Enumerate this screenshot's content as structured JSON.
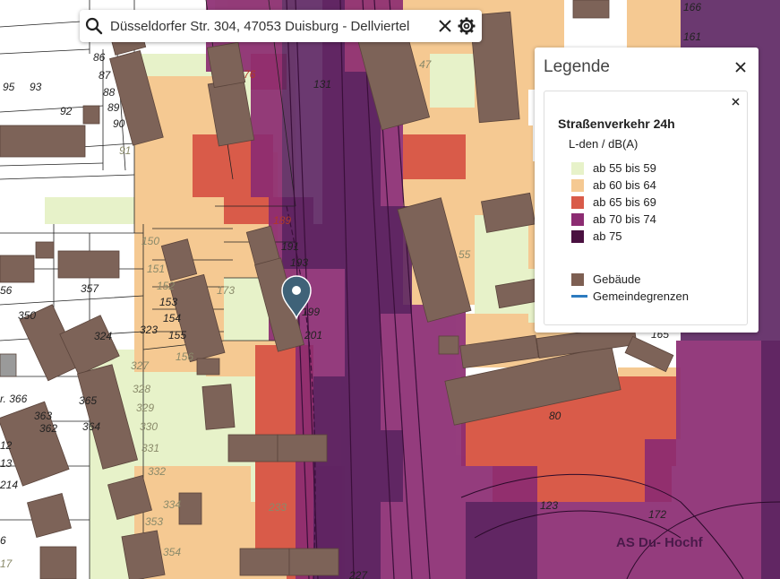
{
  "search": {
    "value": "Düsseldorfer Str. 304, 47053 Duisburg - Dellviertel"
  },
  "legend": {
    "title": "Legende",
    "layer_title": "Straßenverkehr 24h",
    "layer_subtitle": "L-den / dB(A)",
    "noise_classes": [
      {
        "label": "ab 55 bis 59",
        "color": "#e7f2c9"
      },
      {
        "label": "ab 60 bis 64",
        "color": "#f5c992"
      },
      {
        "label": "ab 65 bis 69",
        "color": "#d95b49"
      },
      {
        "label": "ab 70 bis 74",
        "color": "#8c2c72"
      },
      {
        "label": "ab 75",
        "color": "#4a1040"
      }
    ],
    "other_items": [
      {
        "label": "Gebäude",
        "color": "#7d5f52",
        "kind": "fill"
      },
      {
        "label": "Gemeindegrenzen",
        "color": "#2c7bbf",
        "kind": "line"
      }
    ]
  },
  "map": {
    "marker": "location-pin",
    "colors": {
      "building": "#7d6358",
      "building_dark": "#6b5148",
      "parcel_line": "#222222",
      "rail_line": "#5a2a5a"
    },
    "parcel_labels": [
      {
        "t": "166"
      },
      {
        "t": "161"
      },
      {
        "t": "95"
      },
      {
        "t": "93"
      },
      {
        "t": "92"
      },
      {
        "t": "86"
      },
      {
        "t": "87"
      },
      {
        "t": "88"
      },
      {
        "t": "89"
      },
      {
        "t": "90"
      },
      {
        "t": "91"
      },
      {
        "t": "76"
      },
      {
        "t": "131"
      },
      {
        "t": "47"
      },
      {
        "t": "189"
      },
      {
        "t": "191"
      },
      {
        "t": "193"
      },
      {
        "t": "199"
      },
      {
        "t": "201"
      },
      {
        "t": "150"
      },
      {
        "t": "151"
      },
      {
        "t": "152"
      },
      {
        "t": "153"
      },
      {
        "t": "154"
      },
      {
        "t": "155"
      },
      {
        "t": "156"
      },
      {
        "t": "173"
      },
      {
        "t": "357"
      },
      {
        "t": "56"
      },
      {
        "t": "350"
      },
      {
        "t": "324"
      },
      {
        "t": "323"
      },
      {
        "t": "327"
      },
      {
        "t": "328"
      },
      {
        "t": "329"
      },
      {
        "t": "330"
      },
      {
        "t": "331"
      },
      {
        "t": "332"
      },
      {
        "t": "334"
      },
      {
        "t": "353"
      },
      {
        "t": "354"
      },
      {
        "t": "233"
      },
      {
        "t": "366"
      },
      {
        "t": "365"
      },
      {
        "t": "364"
      },
      {
        "t": "363"
      },
      {
        "t": "362"
      },
      {
        "t": "12"
      },
      {
        "t": "13"
      },
      {
        "t": "214"
      },
      {
        "t": "6"
      },
      {
        "t": "17"
      },
      {
        "t": "55"
      },
      {
        "t": "80"
      },
      {
        "t": "123"
      },
      {
        "t": "172"
      },
      {
        "t": "165"
      },
      {
        "t": "227"
      }
    ],
    "place_label": "AS Du- Hochf"
  }
}
